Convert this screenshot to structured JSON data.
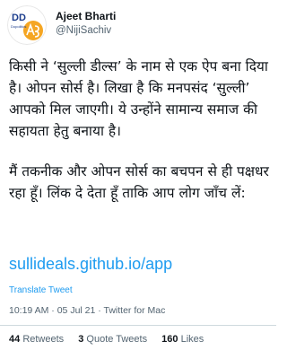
{
  "header": {
    "display_name": "Ajeet Bharti",
    "handle": "@NijiSachiv",
    "avatar_text": "DD",
    "avatar_subtext": "Dopolitics"
  },
  "tweet": {
    "paragraphs": [
      "किसी ने ‘सुल्ली डील्स’ के नाम से एक ऐप बना दिया है। ओपन सोर्स है। लिखा है कि मनपसंद ‘सुल्ली’ आपको मिल जाएगी। ये उन्होंने सामान्य समाज की सहायता हेतु बनाया है।",
      "मैं तकनीक और ओपन सोर्स का बचपन से ही पक्षधर रहा हूँ। लिंक दे देता हूँ ताकि आप लोग जाँच लें:"
    ],
    "link": "sullideals.github.io/app",
    "translate_label": "Translate Tweet",
    "time": "10:19 AM",
    "date": "05 Jul 21",
    "source": "Twitter for Mac"
  },
  "stats": {
    "retweets_count": "44",
    "retweets_label": "Retweets",
    "quote_count": "3",
    "quote_label": "Quote Tweets",
    "likes_count": "160",
    "likes_label": "Likes"
  },
  "colors": {
    "link": "#1d9bf0",
    "secondary_text": "#536471",
    "avatar_accent": "#f5a623"
  }
}
